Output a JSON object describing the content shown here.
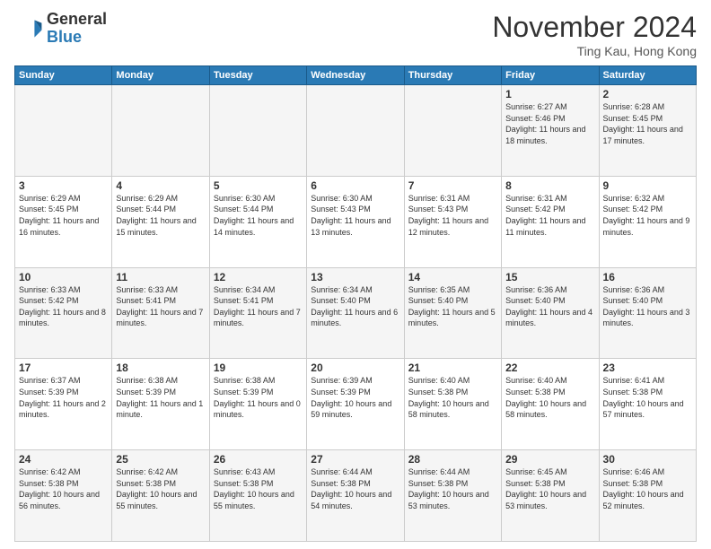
{
  "logo": {
    "general": "General",
    "blue": "Blue"
  },
  "title": "November 2024",
  "location": "Ting Kau, Hong Kong",
  "days_of_week": [
    "Sunday",
    "Monday",
    "Tuesday",
    "Wednesday",
    "Thursday",
    "Friday",
    "Saturday"
  ],
  "weeks": [
    [
      {
        "day": "",
        "info": ""
      },
      {
        "day": "",
        "info": ""
      },
      {
        "day": "",
        "info": ""
      },
      {
        "day": "",
        "info": ""
      },
      {
        "day": "",
        "info": ""
      },
      {
        "day": "1",
        "info": "Sunrise: 6:27 AM\nSunset: 5:46 PM\nDaylight: 11 hours and 18 minutes."
      },
      {
        "day": "2",
        "info": "Sunrise: 6:28 AM\nSunset: 5:45 PM\nDaylight: 11 hours and 17 minutes."
      }
    ],
    [
      {
        "day": "3",
        "info": "Sunrise: 6:29 AM\nSunset: 5:45 PM\nDaylight: 11 hours and 16 minutes."
      },
      {
        "day": "4",
        "info": "Sunrise: 6:29 AM\nSunset: 5:44 PM\nDaylight: 11 hours and 15 minutes."
      },
      {
        "day": "5",
        "info": "Sunrise: 6:30 AM\nSunset: 5:44 PM\nDaylight: 11 hours and 14 minutes."
      },
      {
        "day": "6",
        "info": "Sunrise: 6:30 AM\nSunset: 5:43 PM\nDaylight: 11 hours and 13 minutes."
      },
      {
        "day": "7",
        "info": "Sunrise: 6:31 AM\nSunset: 5:43 PM\nDaylight: 11 hours and 12 minutes."
      },
      {
        "day": "8",
        "info": "Sunrise: 6:31 AM\nSunset: 5:42 PM\nDaylight: 11 hours and 11 minutes."
      },
      {
        "day": "9",
        "info": "Sunrise: 6:32 AM\nSunset: 5:42 PM\nDaylight: 11 hours and 9 minutes."
      }
    ],
    [
      {
        "day": "10",
        "info": "Sunrise: 6:33 AM\nSunset: 5:42 PM\nDaylight: 11 hours and 8 minutes."
      },
      {
        "day": "11",
        "info": "Sunrise: 6:33 AM\nSunset: 5:41 PM\nDaylight: 11 hours and 7 minutes."
      },
      {
        "day": "12",
        "info": "Sunrise: 6:34 AM\nSunset: 5:41 PM\nDaylight: 11 hours and 7 minutes."
      },
      {
        "day": "13",
        "info": "Sunrise: 6:34 AM\nSunset: 5:40 PM\nDaylight: 11 hours and 6 minutes."
      },
      {
        "day": "14",
        "info": "Sunrise: 6:35 AM\nSunset: 5:40 PM\nDaylight: 11 hours and 5 minutes."
      },
      {
        "day": "15",
        "info": "Sunrise: 6:36 AM\nSunset: 5:40 PM\nDaylight: 11 hours and 4 minutes."
      },
      {
        "day": "16",
        "info": "Sunrise: 6:36 AM\nSunset: 5:40 PM\nDaylight: 11 hours and 3 minutes."
      }
    ],
    [
      {
        "day": "17",
        "info": "Sunrise: 6:37 AM\nSunset: 5:39 PM\nDaylight: 11 hours and 2 minutes."
      },
      {
        "day": "18",
        "info": "Sunrise: 6:38 AM\nSunset: 5:39 PM\nDaylight: 11 hours and 1 minute."
      },
      {
        "day": "19",
        "info": "Sunrise: 6:38 AM\nSunset: 5:39 PM\nDaylight: 11 hours and 0 minutes."
      },
      {
        "day": "20",
        "info": "Sunrise: 6:39 AM\nSunset: 5:39 PM\nDaylight: 10 hours and 59 minutes."
      },
      {
        "day": "21",
        "info": "Sunrise: 6:40 AM\nSunset: 5:38 PM\nDaylight: 10 hours and 58 minutes."
      },
      {
        "day": "22",
        "info": "Sunrise: 6:40 AM\nSunset: 5:38 PM\nDaylight: 10 hours and 58 minutes."
      },
      {
        "day": "23",
        "info": "Sunrise: 6:41 AM\nSunset: 5:38 PM\nDaylight: 10 hours and 57 minutes."
      }
    ],
    [
      {
        "day": "24",
        "info": "Sunrise: 6:42 AM\nSunset: 5:38 PM\nDaylight: 10 hours and 56 minutes."
      },
      {
        "day": "25",
        "info": "Sunrise: 6:42 AM\nSunset: 5:38 PM\nDaylight: 10 hours and 55 minutes."
      },
      {
        "day": "26",
        "info": "Sunrise: 6:43 AM\nSunset: 5:38 PM\nDaylight: 10 hours and 55 minutes."
      },
      {
        "day": "27",
        "info": "Sunrise: 6:44 AM\nSunset: 5:38 PM\nDaylight: 10 hours and 54 minutes."
      },
      {
        "day": "28",
        "info": "Sunrise: 6:44 AM\nSunset: 5:38 PM\nDaylight: 10 hours and 53 minutes."
      },
      {
        "day": "29",
        "info": "Sunrise: 6:45 AM\nSunset: 5:38 PM\nDaylight: 10 hours and 53 minutes."
      },
      {
        "day": "30",
        "info": "Sunrise: 6:46 AM\nSunset: 5:38 PM\nDaylight: 10 hours and 52 minutes."
      }
    ]
  ]
}
